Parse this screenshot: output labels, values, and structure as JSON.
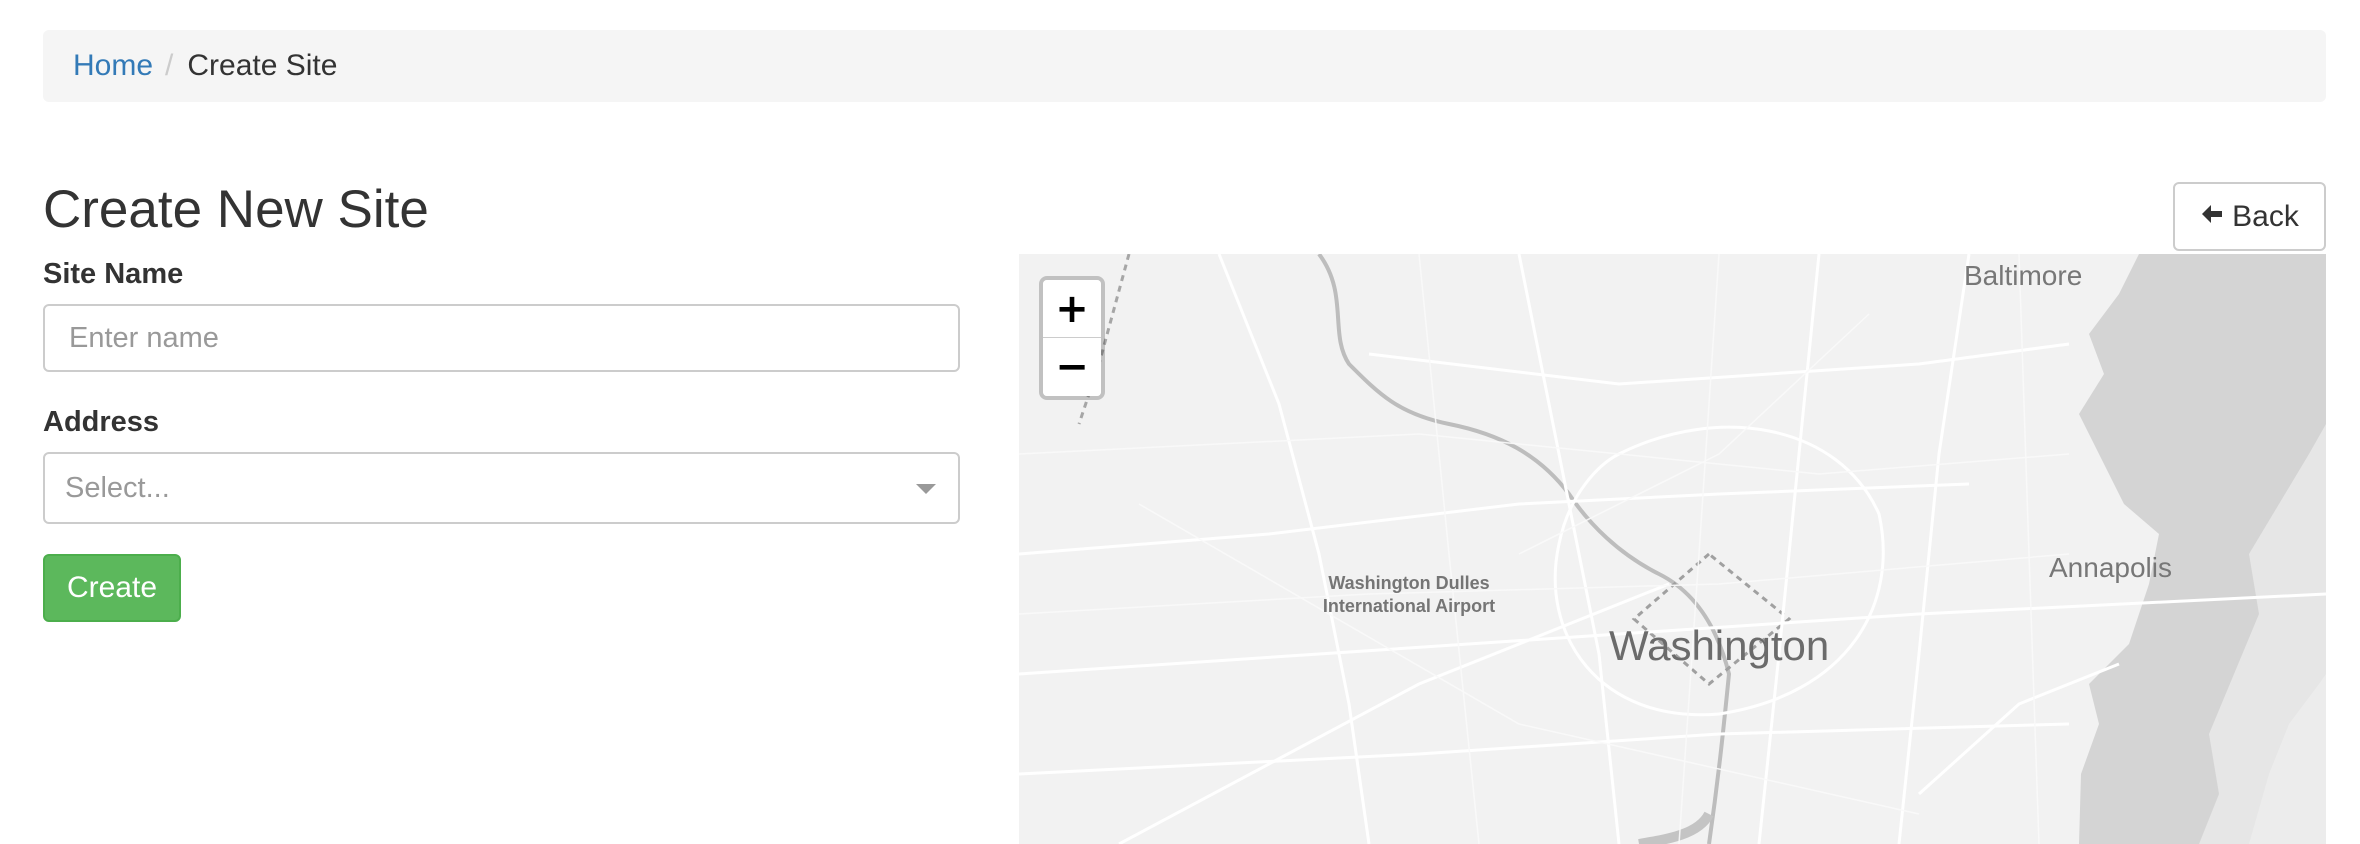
{
  "breadcrumb": {
    "home": "Home",
    "separator": "/",
    "current": "Create Site"
  },
  "page": {
    "title": "Create New Site",
    "back_label": "Back",
    "back_icon": "arrow-left-icon"
  },
  "form": {
    "site_name_label": "Site Name",
    "site_name_placeholder": "Enter name",
    "site_name_value": "",
    "address_label": "Address",
    "address_placeholder": "Select...",
    "create_label": "Create"
  },
  "map": {
    "zoom_in": "+",
    "zoom_out": "−",
    "labels": {
      "baltimore": "Baltimore",
      "annapolis": "Annapolis",
      "washington": "Washington",
      "dulles_line1": "Washington Dulles",
      "dulles_line2": "International Airport"
    },
    "water_color": "#d4d4d4",
    "land_color": "#f2f2f2",
    "road_color": "#ffffff"
  },
  "colors": {
    "link": "#337ab7",
    "success": "#5cb85c",
    "border": "#cccccc"
  }
}
